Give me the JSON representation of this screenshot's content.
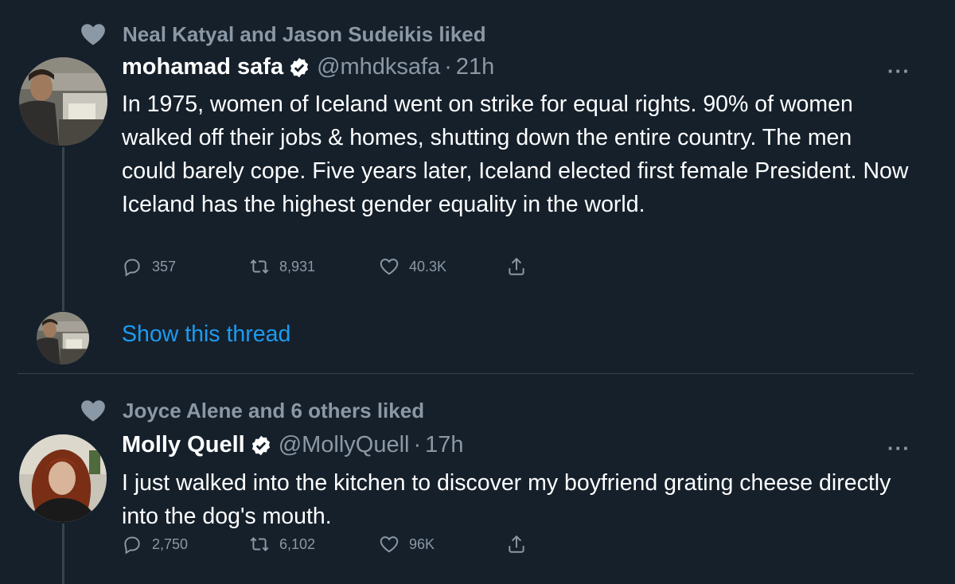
{
  "tweets": [
    {
      "social_context": "Neal Katyal and Jason Sudeikis liked",
      "name": "mohamad safa",
      "handle": "@mhdksafa",
      "separator": "·",
      "time": "21h",
      "more": "···",
      "text": "In 1975, women of Iceland went on strike for equal rights. 90% of women walked off their jobs & homes, shutting down the entire country. The men could barely cope. Five years later, Iceland elected first female President. Now Iceland has the highest gender equality in the world.",
      "replies": "357",
      "retweets": "8,931",
      "likes": "40.3K"
    },
    {
      "social_context": "Joyce Alene and 6 others liked",
      "name": "Molly Quell",
      "handle": "@MollyQuell",
      "separator": "·",
      "time": "17h",
      "more": "···",
      "text": "I just walked into the kitchen to discover my boyfriend grating cheese directly into the dog's mouth.",
      "replies": "2,750",
      "retweets": "6,102",
      "likes": "96K"
    }
  ],
  "show_thread": "Show this thread",
  "colors": {
    "background": "#15202b",
    "text": "#ffffff",
    "muted": "#8b98a5",
    "link": "#1d9bf0",
    "divider": "#38444d"
  },
  "icons": [
    "heart-icon",
    "verified-badge-icon",
    "reply-icon",
    "retweet-icon",
    "like-icon",
    "share-icon",
    "more-icon"
  ]
}
